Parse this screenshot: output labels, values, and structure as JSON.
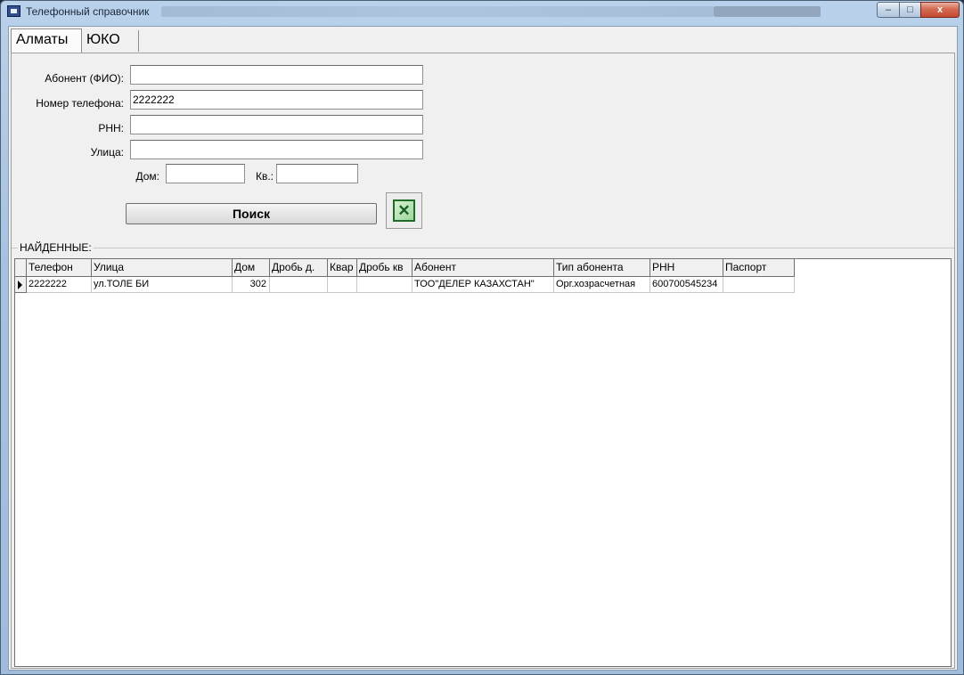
{
  "window": {
    "title": "Телефонный справочник",
    "buttons": {
      "minimize": "–",
      "maximize": "□",
      "close": "x"
    }
  },
  "tabs": [
    {
      "label": "Алматы",
      "active": true
    },
    {
      "label": "ЮКО",
      "active": false
    }
  ],
  "form": {
    "subscriber_label": "Абонент (ФИО):",
    "subscriber_value": "",
    "phone_label": "Номер телефона:",
    "phone_value": "2222222",
    "rnn_label": "РНН:",
    "rnn_value": "",
    "street_label": "Улица:",
    "street_value": "",
    "house_label": "Дом:",
    "house_value": "",
    "apartment_label": "Кв.:",
    "apartment_value": "",
    "search_button": "Поиск",
    "excel_icon": "excel-export-icon"
  },
  "results": {
    "group_title": "НАЙДЕННЫЕ:",
    "columns": [
      "Телефон",
      "Улица",
      "Дом",
      "Дробь д.",
      "Квар",
      "Дробь кв",
      "Абонент",
      "Тип абонента",
      "РНН",
      "Паспорт"
    ],
    "rows": [
      [
        "2222222",
        "ул.ТОЛЕ БИ",
        "302",
        "",
        "",
        "",
        "ТОО\"ДЕЛЕР КАЗАХСТАН\"",
        "Орг.хозрасчетная",
        "600700545234",
        ""
      ]
    ]
  },
  "colors": {
    "titlebar": "#a6c2e0",
    "panel": "#f0f0f0",
    "excel_green": "#1f6b2a"
  }
}
